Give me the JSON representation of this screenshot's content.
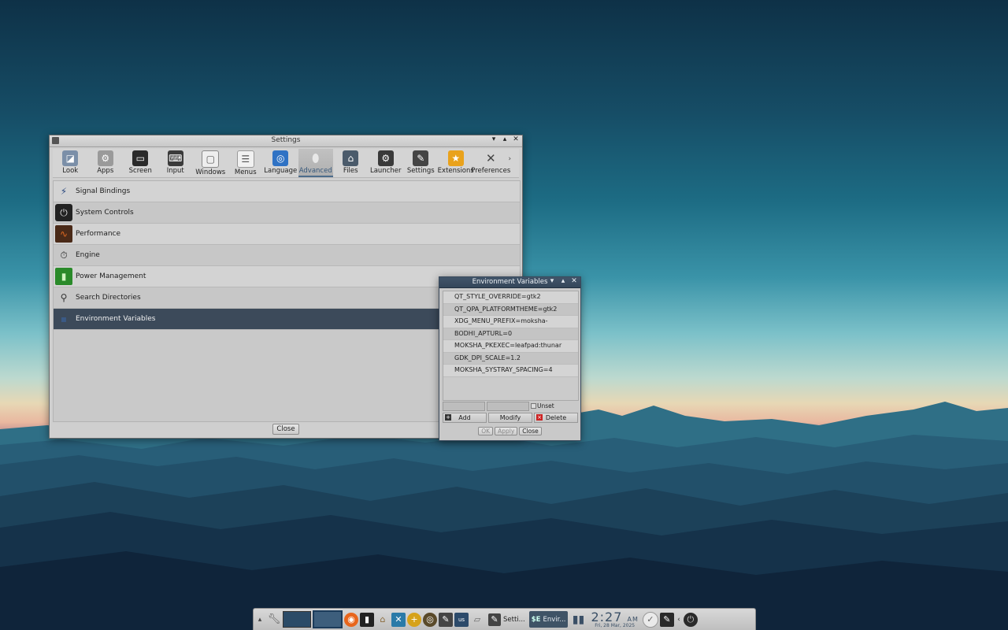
{
  "settings_window": {
    "title": "Settings",
    "toolbar": [
      {
        "label": "Look",
        "icon": "look-icon"
      },
      {
        "label": "Apps",
        "icon": "gear-icon"
      },
      {
        "label": "Screen",
        "icon": "screen-icon"
      },
      {
        "label": "Input",
        "icon": "input-icon"
      },
      {
        "label": "Windows",
        "icon": "windows-icon"
      },
      {
        "label": "Menus",
        "icon": "menus-icon"
      },
      {
        "label": "Language",
        "icon": "globe-icon"
      },
      {
        "label": "Advanced",
        "icon": "advanced-icon",
        "active": true
      },
      {
        "label": "Files",
        "icon": "files-icon"
      },
      {
        "label": "Launcher",
        "icon": "launcher-icon"
      },
      {
        "label": "Settings",
        "icon": "settings-icon"
      },
      {
        "label": "Extensions",
        "icon": "extensions-icon"
      },
      {
        "label": "Preferences",
        "icon": "preferences-icon"
      }
    ],
    "list": [
      {
        "label": "Signal Bindings",
        "icon": "signal-bindings-icon"
      },
      {
        "label": "System Controls",
        "icon": "power-icon"
      },
      {
        "label": "Performance",
        "icon": "performance-icon"
      },
      {
        "label": "Engine",
        "icon": "engine-icon"
      },
      {
        "label": "Power Management",
        "icon": "battery-icon"
      },
      {
        "label": "Search Directories",
        "icon": "microscope-icon"
      },
      {
        "label": "Environment Variables",
        "icon": "env-icon",
        "selected": true
      }
    ],
    "close_label": "Close"
  },
  "env_dialog": {
    "title": "Environment Variables",
    "variables": [
      "QT_STYLE_OVERRIDE=gtk2",
      "QT_QPA_PLATFORMTHEME=gtk2",
      "XDG_MENU_PREFIX=moksha-",
      "BODHI_APTURL=0",
      "MOKSHA_PKEXEC=leafpad:thunar",
      "GDK_DPI_SCALE=1.2",
      "MOKSHA_SYSTRAY_SPACING=4"
    ],
    "unset_label": "Unset",
    "add_label": "Add",
    "modify_label": "Modify",
    "delete_label": "Delete",
    "ok_label": "OK",
    "apply_label": "Apply",
    "close_label": "Close"
  },
  "taskbar": {
    "keyboard_layout": "us",
    "task_settings": "Setti...",
    "task_env": "Envir...",
    "task_env_icon_text": "$E",
    "clock_time": "2:27",
    "clock_ampm": "AM",
    "clock_date": "Fri, 28 Mar, 2025"
  },
  "colors": {
    "selection": "#3c4a5a",
    "accent": "#36577a",
    "dialog_title": "#3a4c60"
  }
}
